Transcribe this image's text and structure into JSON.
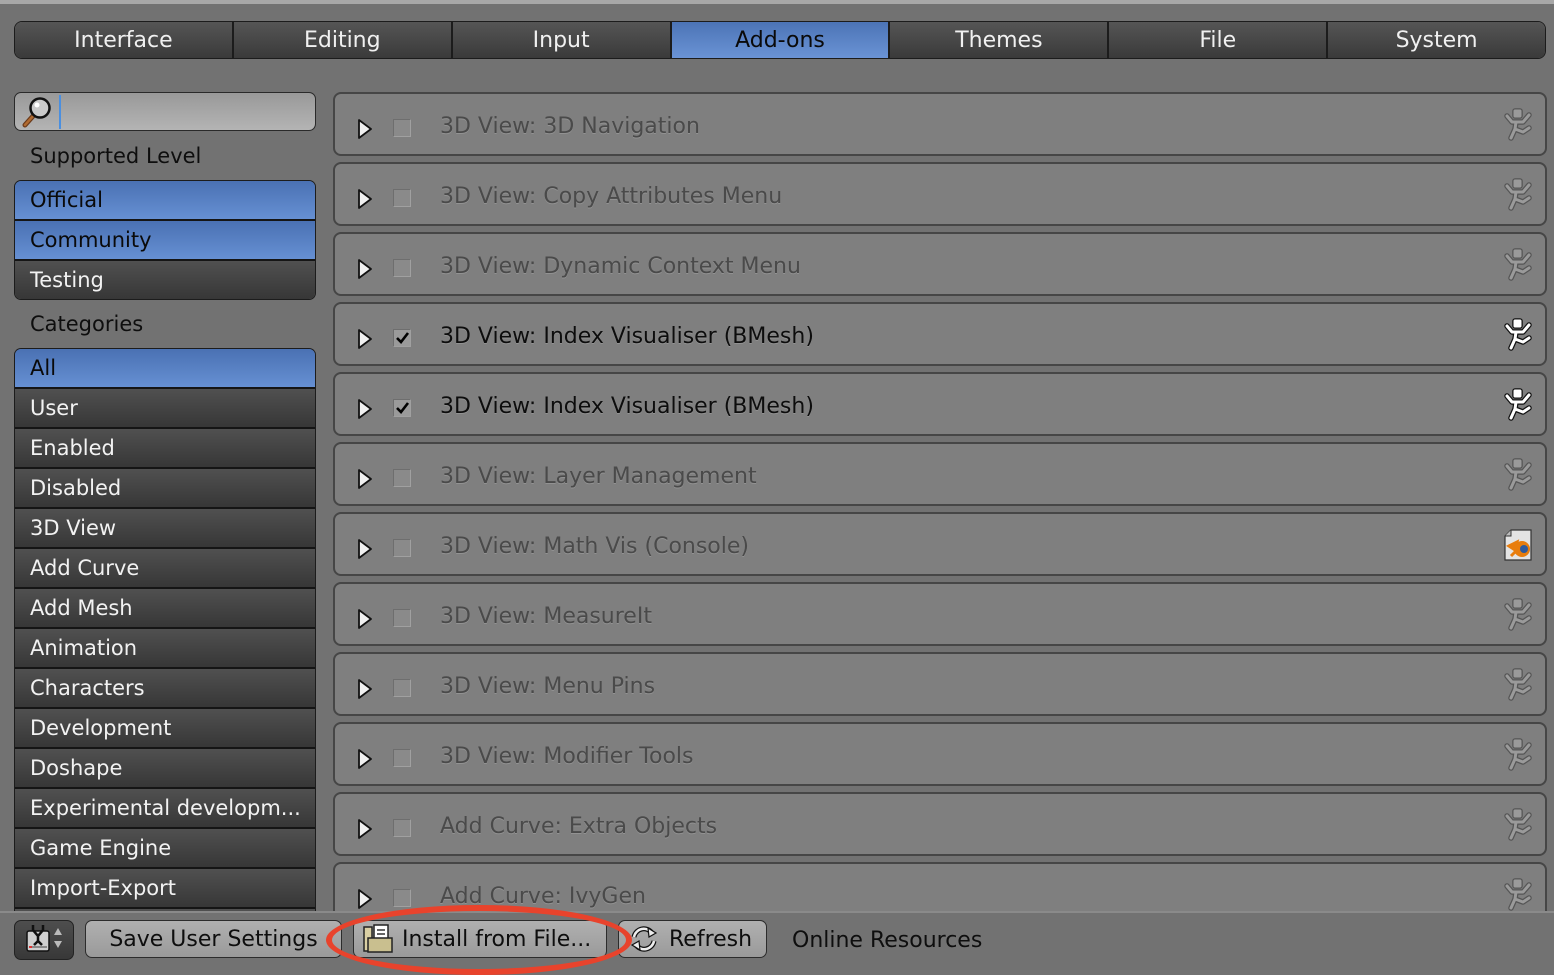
{
  "tabs": [
    {
      "label": "Interface",
      "active": false
    },
    {
      "label": "Editing",
      "active": false
    },
    {
      "label": "Input",
      "active": false
    },
    {
      "label": "Add-ons",
      "active": true
    },
    {
      "label": "Themes",
      "active": false
    },
    {
      "label": "File",
      "active": false
    },
    {
      "label": "System",
      "active": false
    }
  ],
  "search": {
    "value": "",
    "placeholder": ""
  },
  "sidebar": {
    "supported_level_label": "Supported Level",
    "supported_levels": [
      {
        "label": "Official",
        "selected": true
      },
      {
        "label": "Community",
        "selected": true
      },
      {
        "label": "Testing",
        "selected": false
      }
    ],
    "categories_label": "Categories",
    "categories": [
      {
        "label": "All",
        "selected": true
      },
      {
        "label": "User",
        "selected": false
      },
      {
        "label": "Enabled",
        "selected": false
      },
      {
        "label": "Disabled",
        "selected": false
      },
      {
        "label": "3D View",
        "selected": false
      },
      {
        "label": "Add Curve",
        "selected": false
      },
      {
        "label": "Add Mesh",
        "selected": false
      },
      {
        "label": "Animation",
        "selected": false
      },
      {
        "label": "Characters",
        "selected": false
      },
      {
        "label": "Development",
        "selected": false
      },
      {
        "label": "Doshape",
        "selected": false
      },
      {
        "label": "Experimental developm...",
        "selected": false
      },
      {
        "label": "Game Engine",
        "selected": false
      },
      {
        "label": "Import-Export",
        "selected": false
      },
      {
        "label": "",
        "selected": false
      }
    ]
  },
  "addons": [
    {
      "name": "3D View: 3D Navigation",
      "enabled": false,
      "icon": "community-icon"
    },
    {
      "name": "3D View: Copy Attributes Menu",
      "enabled": false,
      "icon": "community-icon"
    },
    {
      "name": "3D View: Dynamic Context Menu",
      "enabled": false,
      "icon": "community-icon"
    },
    {
      "name": "3D View: Index Visualiser (BMesh)",
      "enabled": true,
      "icon": "community-icon"
    },
    {
      "name": "3D View: Index Visualiser (BMesh)",
      "enabled": true,
      "icon": "community-icon"
    },
    {
      "name": "3D View: Layer Management",
      "enabled": false,
      "icon": "community-icon"
    },
    {
      "name": "3D View: Math Vis (Console)",
      "enabled": false,
      "icon": "blender-file-icon"
    },
    {
      "name": "3D View: MeasureIt",
      "enabled": false,
      "icon": "community-icon"
    },
    {
      "name": "3D View: Menu Pins",
      "enabled": false,
      "icon": "community-icon"
    },
    {
      "name": "3D View: Modifier Tools",
      "enabled": false,
      "icon": "community-icon"
    },
    {
      "name": "Add Curve: Extra Objects",
      "enabled": false,
      "icon": "community-icon"
    },
    {
      "name": "Add Curve: IvyGen",
      "enabled": false,
      "icon": "community-icon"
    }
  ],
  "footer": {
    "save_label": "Save User Settings",
    "install_label": "Install from File...",
    "refresh_label": "Refresh",
    "online_label": "Online Resources"
  },
  "colors": {
    "accent": "#5a82c4",
    "highlight_circle": "#e8432c"
  }
}
